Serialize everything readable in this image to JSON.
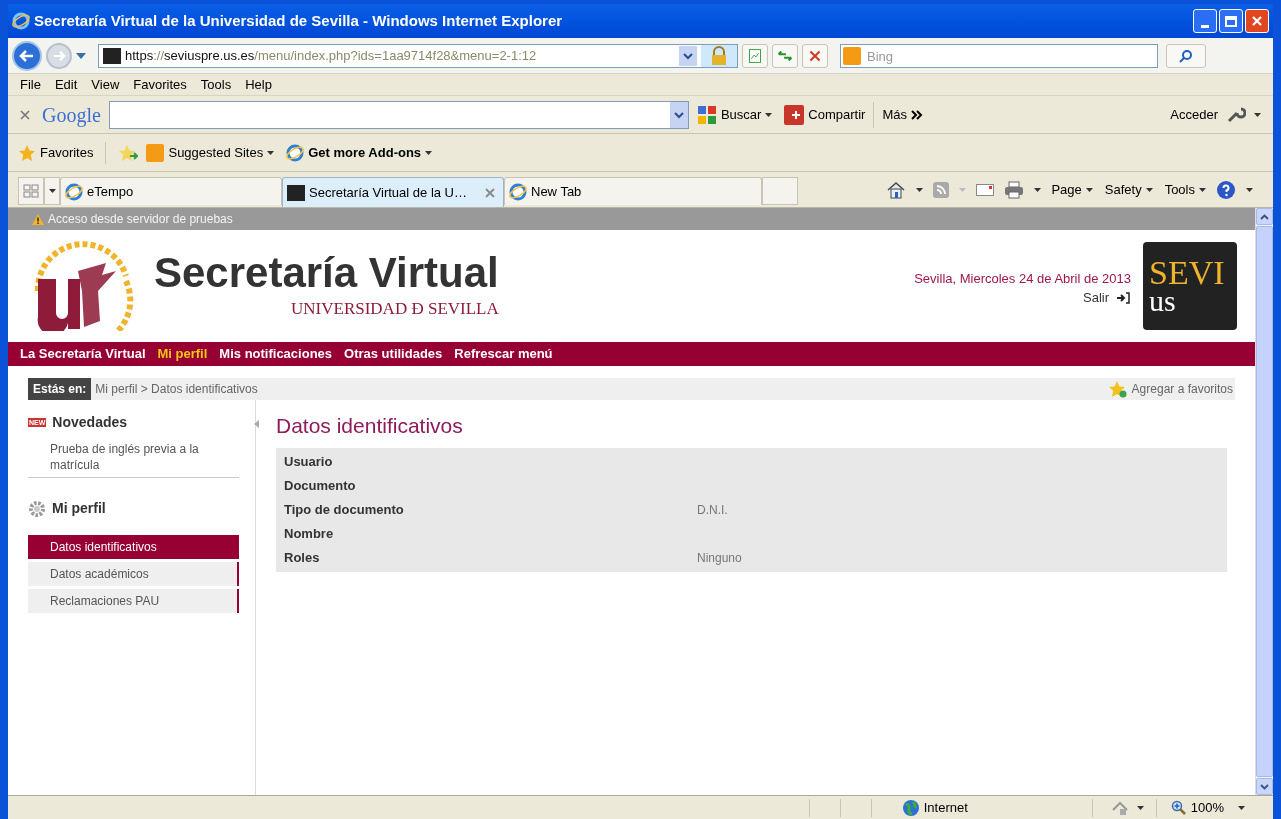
{
  "window": {
    "title": "Secretaría Virtual de la Universidad de Sevilla - Windows Internet Explorer"
  },
  "address_bar": {
    "url_parts": [
      {
        "text": "https",
        "kind": "strong"
      },
      {
        "text": "://",
        "kind": "dim"
      },
      {
        "text": "seviuspre.us.es",
        "kind": "strong"
      },
      {
        "text": "/menu/index.php?ids=1aa9714f28&menu=2-1:12",
        "kind": "dim"
      }
    ]
  },
  "search": {
    "placeholder": "Bing"
  },
  "menu_bar": [
    "File",
    "Edit",
    "View",
    "Favorites",
    "Tools",
    "Help"
  ],
  "google_toolbar": {
    "logo": "Google",
    "buttons": [
      "Buscar",
      "Compartir"
    ],
    "more": "Más",
    "sign_in": "Acceder"
  },
  "favorites_bar": {
    "favorites": "Favorites",
    "items": [
      "Suggested Sites",
      "Get more Add-ons"
    ]
  },
  "tabs": [
    {
      "label": "eTempo",
      "selected": false
    },
    {
      "label": "Secretaría Virtual de la U…",
      "selected": true
    },
    {
      "label": "New Tab",
      "selected": false
    }
  ],
  "command_bar": [
    "Page",
    "Safety",
    "Tools"
  ],
  "page": {
    "notice": "Acceso desde servidor de pruebas",
    "title": "Secretaría Virtual",
    "subtitle": "UNIVERSIDAD Ð SEVILLA",
    "date": "Sevilla, Miercoles 24 de Abril de 2013",
    "logout": "Salir",
    "badge_logo": [
      "SEVI",
      "us"
    ],
    "nav": [
      {
        "label": "La Secretaría Virtual",
        "selected": false
      },
      {
        "label": "Mi perfil",
        "selected": true
      },
      {
        "label": "Mis notificaciones",
        "selected": false
      },
      {
        "label": "Otras utilidades",
        "selected": false
      },
      {
        "label": "Refrescar menú",
        "selected": false
      }
    ],
    "breadcrumb": {
      "label": "Estás en:",
      "path": "Mi perfil > Datos identificativos",
      "add_favorite": "Agregar a favoritos"
    },
    "sidebar": [
      {
        "kind": "news",
        "badge": "NEW",
        "title": "Novedades",
        "items": [
          {
            "label": "Prueba de inglés previa a la matrícula",
            "selected": false
          }
        ]
      },
      {
        "kind": "menu",
        "title": "Mi perfil",
        "items": [
          {
            "label": "Datos identificativos",
            "selected": true
          },
          {
            "label": "Datos académicos",
            "selected": false
          },
          {
            "label": "Reclamaciones PAU",
            "selected": false
          }
        ]
      }
    ],
    "heading": "Datos identificativos",
    "fields": [
      {
        "label": "Usuario"
      },
      {
        "label": "Documento"
      },
      {
        "label": "Tipo de documento",
        "value": "D.N.I."
      },
      {
        "label": "Nombre"
      },
      {
        "label": "Roles",
        "value": "Ninguno"
      }
    ]
  },
  "status_bar": {
    "zone": "Internet",
    "zoom": "100%"
  }
}
